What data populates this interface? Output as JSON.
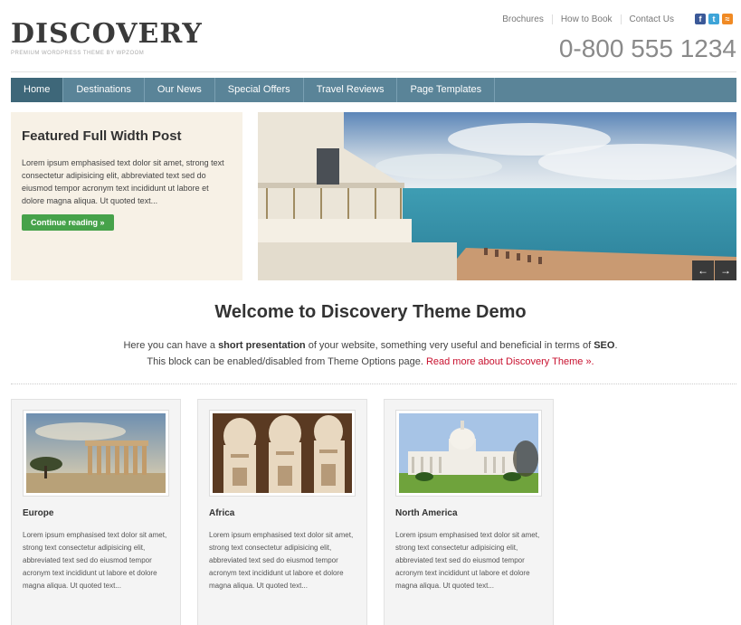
{
  "header": {
    "logo": "DISCOVERY",
    "tagline": "PREMIUM WORDPRESS THEME BY WPZOOM",
    "top_links": [
      "Brochures",
      "How to Book",
      "Contact Us"
    ],
    "social_icons": [
      "facebook-icon",
      "twitter-icon",
      "rss-icon"
    ],
    "phone": "0-800 555 1234"
  },
  "nav": {
    "items": [
      "Home",
      "Destinations",
      "Our News",
      "Special Offers",
      "Travel Reviews",
      "Page Templates"
    ],
    "active": "Home",
    "color": "#5a8498"
  },
  "featured": {
    "title": "Featured Full Width Post",
    "text": "Lorem ipsum emphasised text dolor sit amet, strong text consectetur adipisicing elit, abbreviated text sed do eiusmod tempor acronym text incididunt ut labore et dolore magna aliqua. Ut quoted text...",
    "button": "Continue reading »",
    "prev_arrow": "←",
    "next_arrow": "→"
  },
  "welcome": {
    "title": "Welcome to Discovery Theme Demo",
    "line1_a": "Here you can have a ",
    "line1_b": "short presentation",
    "line1_c": " of your website, something very useful and beneficial in terms of ",
    "line1_d": "SEO",
    "line1_e": ".",
    "line2_a": "This block can be enabled/disabled from Theme Options page. ",
    "line2_link": "Read more about Discovery Theme »."
  },
  "cards": [
    {
      "title": "Europe",
      "text": "Lorem ipsum emphasised text dolor sit amet, strong text consectetur adipisicing elit, abbreviated text sed do eiusmod tempor acronym text incididunt ut labore et dolore magna aliqua. Ut quoted text..."
    },
    {
      "title": "Africa",
      "text": "Lorem ipsum emphasised text dolor sit amet, strong text consectetur adipisicing elit, abbreviated text sed do eiusmod tempor acronym text incididunt ut labore et dolore magna aliqua. Ut quoted text..."
    },
    {
      "title": "North America",
      "text": "Lorem ipsum emphasised text dolor sit amet, strong text consectetur adipisicing elit, abbreviated text sed do eiusmod tempor acronym text incididunt ut labore et dolore magna aliqua. Ut quoted text..."
    }
  ]
}
